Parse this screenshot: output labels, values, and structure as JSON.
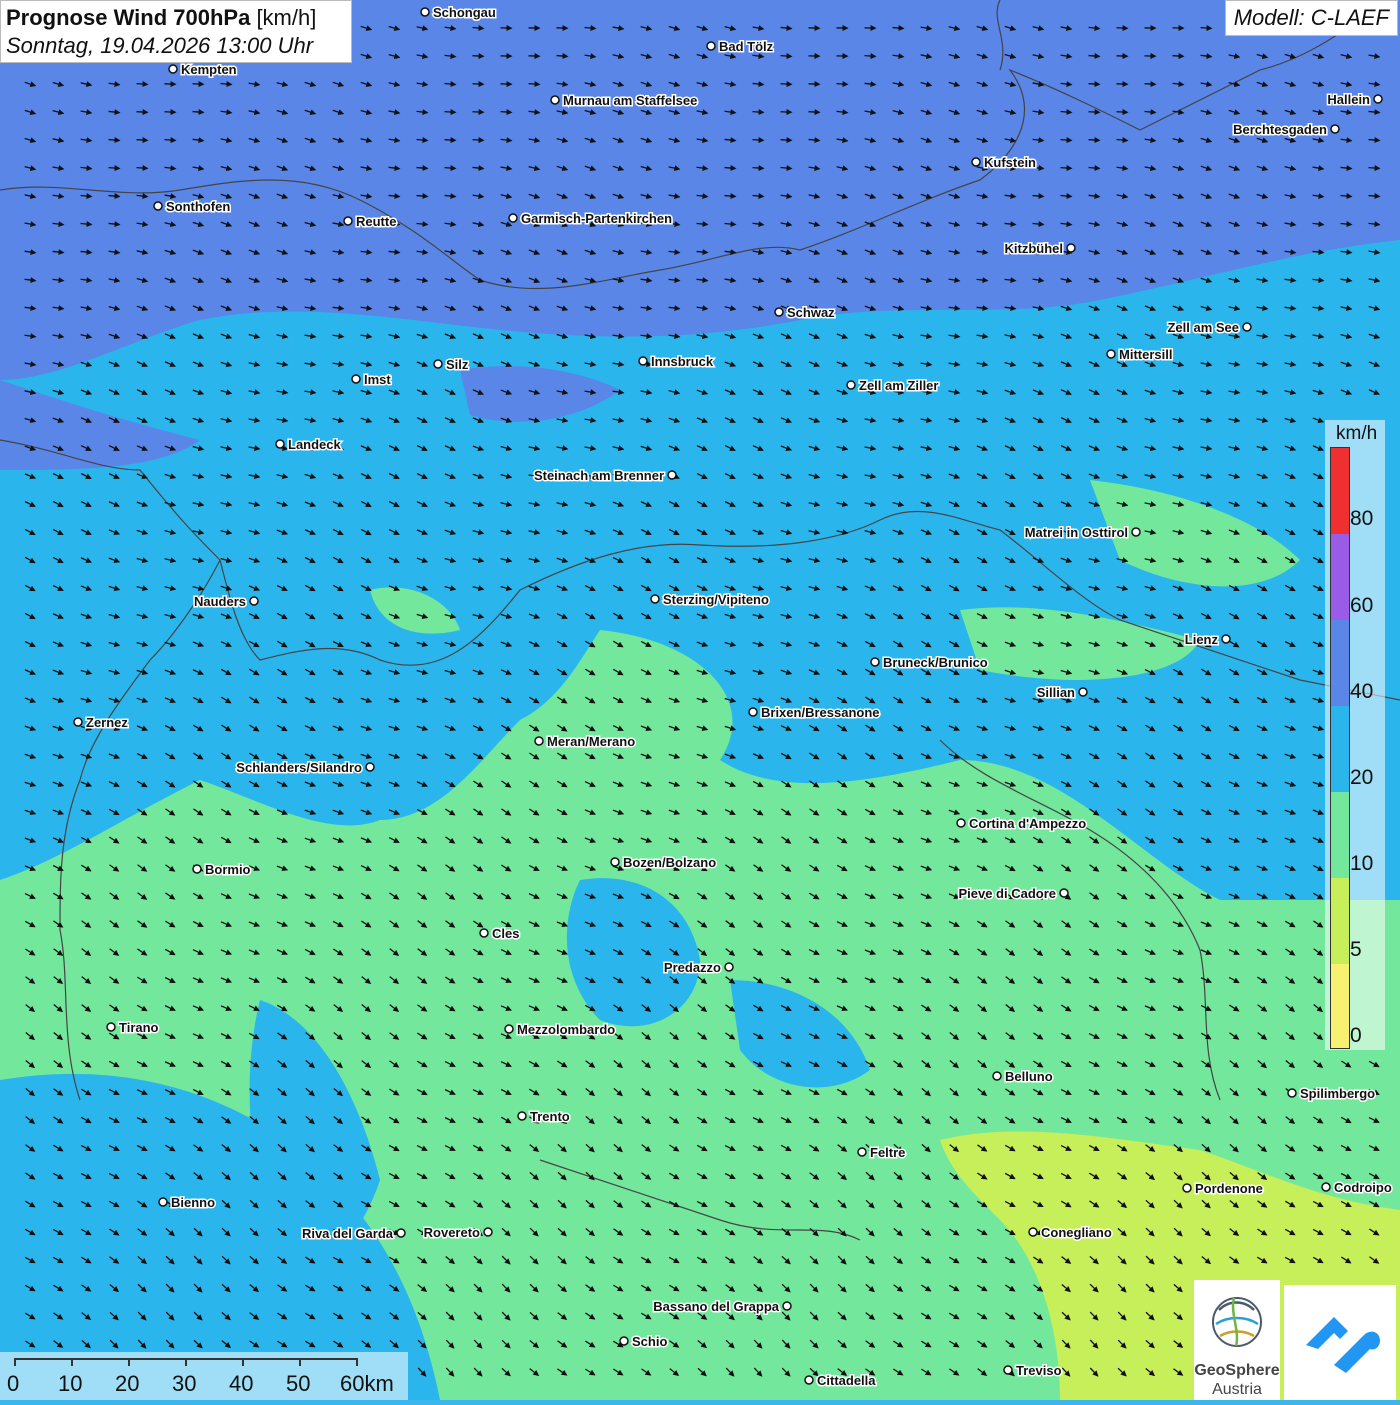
{
  "header": {
    "title": "Prognose Wind 700hPa",
    "unit": "[km/h]",
    "datetime": "Sonntag, 19.04.2026 13:00 Uhr",
    "model": "Modell: C-LAEF"
  },
  "legend": {
    "unit": "km/h",
    "ticks": [
      "80",
      "60",
      "40",
      "20",
      "10",
      "5",
      "0"
    ],
    "colors": {
      "above_80": "#f03030",
      "60_80": "#9a5ce6",
      "40_60": "#5a86e8",
      "20_40": "#2ab6ec",
      "10_20": "#73e89c",
      "5_10": "#c6ef5a",
      "0_5": "#f8f070"
    }
  },
  "scalebar": {
    "labels": [
      "0",
      "10",
      "20",
      "30",
      "40",
      "50",
      "60km"
    ]
  },
  "cities": [
    {
      "name": "Schongau"
    },
    {
      "name": "Bad Tölz"
    },
    {
      "name": "Kempten"
    },
    {
      "name": "Murnau am Staffelsee"
    },
    {
      "name": "Hallein"
    },
    {
      "name": "Berchtesgaden"
    },
    {
      "name": "Kufstein"
    },
    {
      "name": "Sonthofen"
    },
    {
      "name": "Reutte"
    },
    {
      "name": "Garmisch-Partenkirchen"
    },
    {
      "name": "Kitzbühel"
    },
    {
      "name": "Schwaz"
    },
    {
      "name": "Zell am See"
    },
    {
      "name": "Mittersill"
    },
    {
      "name": "Innsbruck"
    },
    {
      "name": "Silz"
    },
    {
      "name": "Imst"
    },
    {
      "name": "Zell am Ziller"
    },
    {
      "name": "Landeck"
    },
    {
      "name": "Steinach am Brenner"
    },
    {
      "name": "Matrei in Osttirol"
    },
    {
      "name": "Nauders"
    },
    {
      "name": "Sterzing/Vipiteno"
    },
    {
      "name": "Lienz"
    },
    {
      "name": "Bruneck/Brunico"
    },
    {
      "name": "Sillian"
    },
    {
      "name": "Brixen/Bressanone"
    },
    {
      "name": "Zernez"
    },
    {
      "name": "Meran/Merano"
    },
    {
      "name": "Schlanders/Silandro"
    },
    {
      "name": "Cortina d'Ampezzo"
    },
    {
      "name": "Bozen/Bolzano"
    },
    {
      "name": "Bormio"
    },
    {
      "name": "Pieve di Cadore"
    },
    {
      "name": "Cles"
    },
    {
      "name": "Predazzo"
    },
    {
      "name": "Tirano"
    },
    {
      "name": "Mezzolombardo"
    },
    {
      "name": "Belluno"
    },
    {
      "name": "Spilimbergo"
    },
    {
      "name": "Trento"
    },
    {
      "name": "Feltre"
    },
    {
      "name": "Pordenone"
    },
    {
      "name": "Codroipo"
    },
    {
      "name": "Bienno"
    },
    {
      "name": "Riva del Garda"
    },
    {
      "name": "Rovereto"
    },
    {
      "name": "Conegliano"
    },
    {
      "name": "Bassano del Grappa"
    },
    {
      "name": "Schio"
    },
    {
      "name": "Treviso"
    },
    {
      "name": "Cittadella"
    }
  ],
  "logos": {
    "geosphere_line1": "GeoSphere",
    "geosphere_line2": "Austria",
    "app": "app-logo-icon"
  }
}
